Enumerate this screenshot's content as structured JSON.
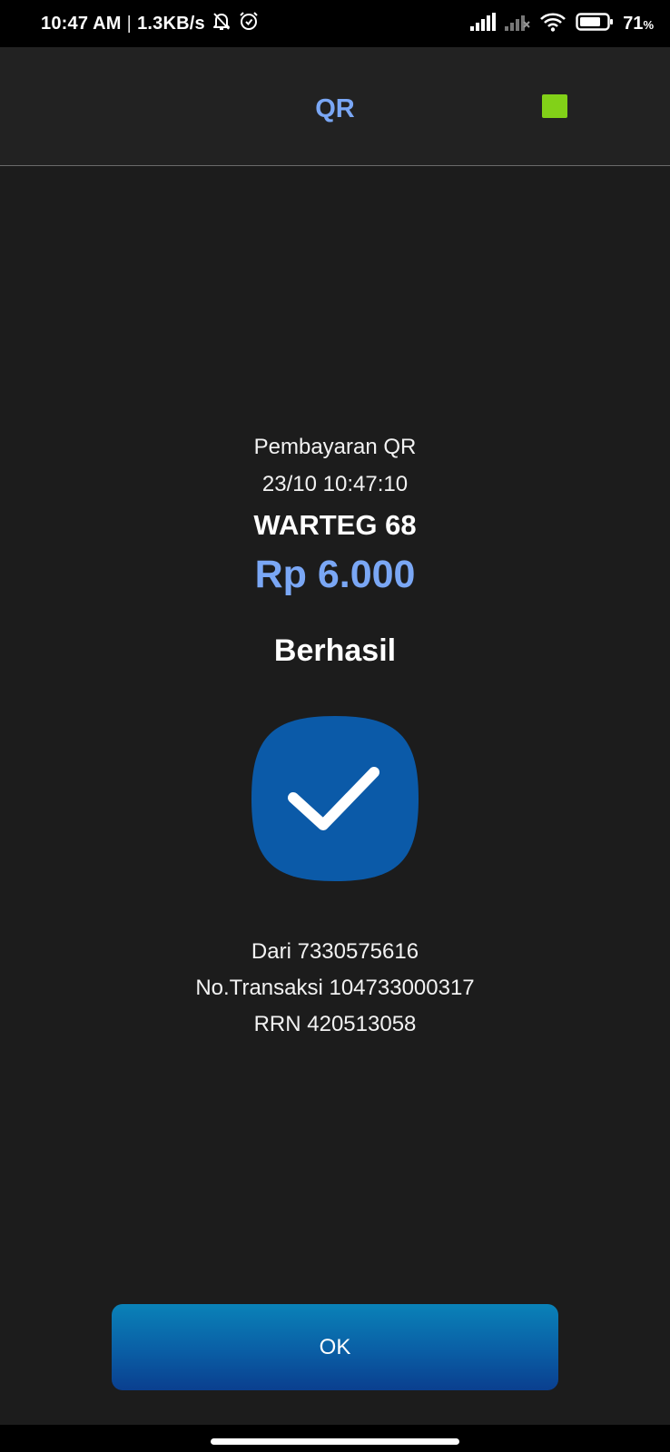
{
  "status_bar": {
    "time": "10:47 AM",
    "separator": "|",
    "speed": "1.3KB/s",
    "icons": [
      "notifications-off-icon",
      "alarm-icon",
      "signal-icon",
      "signal-no-sim-icon",
      "wifi-icon",
      "battery-icon"
    ],
    "battery_level": "71",
    "battery_unit": "%"
  },
  "header": {
    "title": "QR",
    "indicator_color": "#82d118"
  },
  "receipt": {
    "type_label": "Pembayaran QR",
    "datetime": "23/10 10:47:10",
    "merchant": "WARTEG 68",
    "amount": "Rp 6.000",
    "status": "Berhasil",
    "status_icon": "check-icon",
    "from": "Dari 7330575616",
    "transaction_no": "No.Transaksi 104733000317",
    "rrn": "RRN 420513058"
  },
  "actions": {
    "ok_label": "OK"
  },
  "colors": {
    "accent": "#7aa7f5",
    "badge": "#0b5aa8",
    "background": "#1c1c1c",
    "header_bg": "#222222"
  }
}
